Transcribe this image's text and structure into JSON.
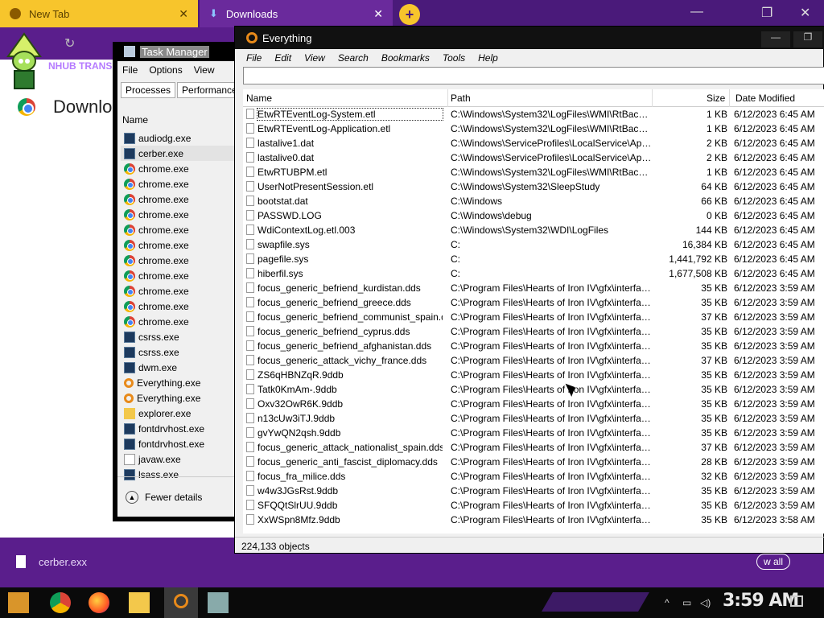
{
  "browser": {
    "tabs": [
      {
        "label": "New Tab"
      },
      {
        "label": "Downloads"
      }
    ],
    "page_title": "Downlo",
    "omnibox_text": "NHUB TRANS",
    "download_file": "cerber.exx",
    "show_all": "w all",
    "new_tab_glyph": "+",
    "close_glyph": "✕",
    "minimize_glyph": "—",
    "maximize_glyph": "❐",
    "colors": {
      "tab_active": "#6a2a9c",
      "tab_inactive": "#f7c52c",
      "theme": "#5a1e8c"
    }
  },
  "task_manager": {
    "title": "Task Manager",
    "menu": [
      "File",
      "Options",
      "View"
    ],
    "tabs": [
      "Processes",
      "Performance"
    ],
    "column": "Name",
    "processes": [
      {
        "name": "audiodg.exe",
        "icon": "exe-icon"
      },
      {
        "name": "cerber.exe",
        "icon": "exe-icon"
      },
      {
        "name": "chrome.exe",
        "icon": "chrome-icon"
      },
      {
        "name": "chrome.exe",
        "icon": "chrome-icon"
      },
      {
        "name": "chrome.exe",
        "icon": "chrome-icon"
      },
      {
        "name": "chrome.exe",
        "icon": "chrome-icon"
      },
      {
        "name": "chrome.exe",
        "icon": "chrome-icon"
      },
      {
        "name": "chrome.exe",
        "icon": "chrome-icon"
      },
      {
        "name": "chrome.exe",
        "icon": "chrome-icon"
      },
      {
        "name": "chrome.exe",
        "icon": "chrome-icon"
      },
      {
        "name": "chrome.exe",
        "icon": "chrome-icon"
      },
      {
        "name": "chrome.exe",
        "icon": "chrome-icon"
      },
      {
        "name": "chrome.exe",
        "icon": "chrome-icon"
      },
      {
        "name": "csrss.exe",
        "icon": "exe-icon"
      },
      {
        "name": "csrss.exe",
        "icon": "exe-icon"
      },
      {
        "name": "dwm.exe",
        "icon": "exe-icon"
      },
      {
        "name": "Everything.exe",
        "icon": "everything-icon"
      },
      {
        "name": "Everything.exe",
        "icon": "everything-icon"
      },
      {
        "name": "explorer.exe",
        "icon": "folder-icon"
      },
      {
        "name": "fontdrvhost.exe",
        "icon": "exe-icon"
      },
      {
        "name": "fontdrvhost.exe",
        "icon": "exe-icon"
      },
      {
        "name": "javaw.exe",
        "icon": "java-icon"
      },
      {
        "name": "lsass.exe",
        "icon": "exe-icon"
      }
    ],
    "fewer_details": "Fewer details"
  },
  "everything": {
    "title": "Everything",
    "menu": [
      "File",
      "Edit",
      "View",
      "Search",
      "Bookmarks",
      "Tools",
      "Help"
    ],
    "search_value": "",
    "columns": {
      "name": "Name",
      "path": "Path",
      "size": "Size",
      "date": "Date Modified"
    },
    "files": [
      {
        "name": "EtwRTEventLog-System.etl",
        "path": "C:\\Windows\\System32\\LogFiles\\WMI\\RtBackup",
        "size": "1 KB",
        "date": "6/12/2023 6:45 AM"
      },
      {
        "name": "EtwRTEventLog-Application.etl",
        "path": "C:\\Windows\\System32\\LogFiles\\WMI\\RtBackup",
        "size": "1 KB",
        "date": "6/12/2023 6:45 AM"
      },
      {
        "name": "lastalive1.dat",
        "path": "C:\\Windows\\ServiceProfiles\\LocalService\\AppDat...",
        "size": "2 KB",
        "date": "6/12/2023 6:45 AM"
      },
      {
        "name": "lastalive0.dat",
        "path": "C:\\Windows\\ServiceProfiles\\LocalService\\AppDat...",
        "size": "2 KB",
        "date": "6/12/2023 6:45 AM"
      },
      {
        "name": "EtwRTUBPM.etl",
        "path": "C:\\Windows\\System32\\LogFiles\\WMI\\RtBackup",
        "size": "1 KB",
        "date": "6/12/2023 6:45 AM"
      },
      {
        "name": "UserNotPresentSession.etl",
        "path": "C:\\Windows\\System32\\SleepStudy",
        "size": "64 KB",
        "date": "6/12/2023 6:45 AM"
      },
      {
        "name": "bootstat.dat",
        "path": "C:\\Windows",
        "size": "66 KB",
        "date": "6/12/2023 6:45 AM"
      },
      {
        "name": "PASSWD.LOG",
        "path": "C:\\Windows\\debug",
        "size": "0 KB",
        "date": "6/12/2023 6:45 AM"
      },
      {
        "name": "WdiContextLog.etl.003",
        "path": "C:\\Windows\\System32\\WDI\\LogFiles",
        "size": "144 KB",
        "date": "6/12/2023 6:45 AM"
      },
      {
        "name": "swapfile.sys",
        "path": "C:",
        "size": "16,384 KB",
        "date": "6/12/2023 6:45 AM"
      },
      {
        "name": "pagefile.sys",
        "path": "C:",
        "size": "1,441,792 KB",
        "date": "6/12/2023 6:45 AM"
      },
      {
        "name": "hiberfil.sys",
        "path": "C:",
        "size": "1,677,508 KB",
        "date": "6/12/2023 6:45 AM"
      },
      {
        "name": "focus_generic_befriend_kurdistan.dds",
        "path": "C:\\Program Files\\Hearts of Iron IV\\gfx\\interface\\...",
        "size": "35 KB",
        "date": "6/12/2023 3:59 AM"
      },
      {
        "name": "focus_generic_befriend_greece.dds",
        "path": "C:\\Program Files\\Hearts of Iron IV\\gfx\\interface\\...",
        "size": "35 KB",
        "date": "6/12/2023 3:59 AM"
      },
      {
        "name": "focus_generic_befriend_communist_spain.dds",
        "path": "C:\\Program Files\\Hearts of Iron IV\\gfx\\interface\\...",
        "size": "37 KB",
        "date": "6/12/2023 3:59 AM"
      },
      {
        "name": "focus_generic_befriend_cyprus.dds",
        "path": "C:\\Program Files\\Hearts of Iron IV\\gfx\\interface\\...",
        "size": "35 KB",
        "date": "6/12/2023 3:59 AM"
      },
      {
        "name": "focus_generic_befriend_afghanistan.dds",
        "path": "C:\\Program Files\\Hearts of Iron IV\\gfx\\interface\\...",
        "size": "35 KB",
        "date": "6/12/2023 3:59 AM"
      },
      {
        "name": "focus_generic_attack_vichy_france.dds",
        "path": "C:\\Program Files\\Hearts of Iron IV\\gfx\\interface\\...",
        "size": "37 KB",
        "date": "6/12/2023 3:59 AM"
      },
      {
        "name": "ZS6qHBNZqR.9ddb",
        "path": "C:\\Program Files\\Hearts of Iron IV\\gfx\\interface\\...",
        "size": "35 KB",
        "date": "6/12/2023 3:59 AM"
      },
      {
        "name": "Tatk0KmAm-.9ddb",
        "path": "C:\\Program Files\\Hearts of Iron IV\\gfx\\interface\\...",
        "size": "35 KB",
        "date": "6/12/2023 3:59 AM"
      },
      {
        "name": "Oxv32OwR6K.9ddb",
        "path": "C:\\Program Files\\Hearts of Iron IV\\gfx\\interface\\...",
        "size": "35 KB",
        "date": "6/12/2023 3:59 AM"
      },
      {
        "name": "n13cUw3iTJ.9ddb",
        "path": "C:\\Program Files\\Hearts of Iron IV\\gfx\\interface\\...",
        "size": "35 KB",
        "date": "6/12/2023 3:59 AM"
      },
      {
        "name": "gvYwQN2qsh.9ddb",
        "path": "C:\\Program Files\\Hearts of Iron IV\\gfx\\interface\\...",
        "size": "35 KB",
        "date": "6/12/2023 3:59 AM"
      },
      {
        "name": "focus_generic_attack_nationalist_spain.dds",
        "path": "C:\\Program Files\\Hearts of Iron IV\\gfx\\interface\\...",
        "size": "37 KB",
        "date": "6/12/2023 3:59 AM"
      },
      {
        "name": "focus_generic_anti_fascist_diplomacy.dds",
        "path": "C:\\Program Files\\Hearts of Iron IV\\gfx\\interface\\...",
        "size": "28 KB",
        "date": "6/12/2023 3:59 AM"
      },
      {
        "name": "focus_fra_milice.dds",
        "path": "C:\\Program Files\\Hearts of Iron IV\\gfx\\interface\\...",
        "size": "32 KB",
        "date": "6/12/2023 3:59 AM"
      },
      {
        "name": "w4w3JGsRst.9ddb",
        "path": "C:\\Program Files\\Hearts of Iron IV\\gfx\\interface\\...",
        "size": "35 KB",
        "date": "6/12/2023 3:59 AM"
      },
      {
        "name": "SFQQtSlrUU.9ddb",
        "path": "C:\\Program Files\\Hearts of Iron IV\\gfx\\interface\\...",
        "size": "35 KB",
        "date": "6/12/2023 3:59 AM"
      },
      {
        "name": "XxWSpn8Mfz.9ddb",
        "path": "C:\\Program Files\\Hearts of Iron IV\\gfx\\interface\\...",
        "size": "35 KB",
        "date": "6/12/2023 3:58 AM"
      }
    ],
    "status": "224,133 objects"
  },
  "taskbar": {
    "clock": "3:59 AM",
    "pinned": [
      "start-icon",
      "chrome-icon",
      "firefox-icon",
      "file-explorer-icon",
      "everything-icon",
      "task-manager-icon"
    ]
  }
}
